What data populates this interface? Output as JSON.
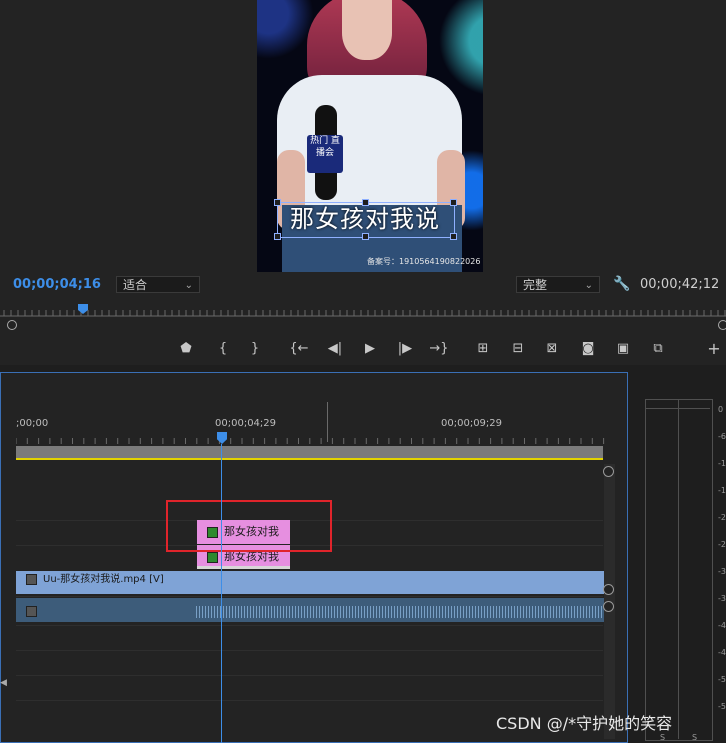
{
  "monitor": {
    "subtitle": "那女孩对我说",
    "watermark": "备案号：1910564190822026",
    "mic_logo": "热门 直播会",
    "current_timecode": "00;00;04;16",
    "fit_select": "适合",
    "quality_select": "完整",
    "total_timecode": "00;00;42;12"
  },
  "transport": {
    "buttons": [
      "marker",
      "mark-in",
      "mark-out",
      "go-to-in",
      "step-back",
      "play",
      "step-forward",
      "go-to-out",
      "insert",
      "overwrite",
      "lift",
      "export-frame",
      "comparison",
      "multi",
      "add"
    ]
  },
  "timeline": {
    "ruler_labels": [
      ";00;00",
      "00;00;04;29",
      "00;00;09;29"
    ],
    "caption_clip_1": "那女孩对我",
    "caption_clip_2": "那女孩对我",
    "video_clip": "Uu-那女孩对我说.mp4 [V]"
  },
  "meter": {
    "ticks": [
      "0",
      "-6",
      "-1",
      "-1",
      "-2",
      "-2",
      "-3",
      "-3",
      "-4",
      "-4",
      "-5",
      "-5"
    ],
    "footer": [
      "S",
      "S"
    ]
  },
  "overlay": {
    "csdn": "CSDN @/*守护她的笑容"
  }
}
